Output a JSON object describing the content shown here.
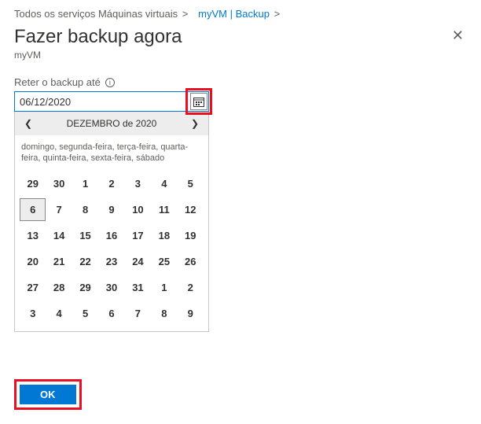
{
  "breadcrumbs": {
    "item1": "Todos os serviços",
    "item2": "Máquinas virtuais",
    "item3": "myVM | Backup",
    "sep": ">"
  },
  "header": {
    "title": "Fazer backup agora",
    "subtitle": "myVM",
    "close_glyph": "✕"
  },
  "field": {
    "label": "Reter o backup até",
    "info_glyph": "i",
    "value": "06/12/2020"
  },
  "calendar": {
    "title": "DEZEMBRO de 2020",
    "prev_glyph": "❮",
    "next_glyph": "❯",
    "daynames": "domingo, segunda-feira, terça-feira, quarta-feira, quinta-feira, sexta-feira, sábado",
    "weeks": [
      [
        {
          "d": "29",
          "other": true
        },
        {
          "d": "30",
          "other": true
        },
        {
          "d": "1"
        },
        {
          "d": "2"
        },
        {
          "d": "3"
        },
        {
          "d": "4"
        },
        {
          "d": "5"
        }
      ],
      [
        {
          "d": "6",
          "selected": true
        },
        {
          "d": "7"
        },
        {
          "d": "8"
        },
        {
          "d": "9"
        },
        {
          "d": "10"
        },
        {
          "d": "11"
        },
        {
          "d": "12"
        }
      ],
      [
        {
          "d": "13"
        },
        {
          "d": "14"
        },
        {
          "d": "15"
        },
        {
          "d": "16"
        },
        {
          "d": "17"
        },
        {
          "d": "18"
        },
        {
          "d": "19"
        }
      ],
      [
        {
          "d": "20"
        },
        {
          "d": "21"
        },
        {
          "d": "22"
        },
        {
          "d": "23"
        },
        {
          "d": "24"
        },
        {
          "d": "25"
        },
        {
          "d": "26"
        }
      ],
      [
        {
          "d": "27"
        },
        {
          "d": "28"
        },
        {
          "d": "29"
        },
        {
          "d": "30"
        },
        {
          "d": "31"
        },
        {
          "d": "1",
          "other": true
        },
        {
          "d": "2",
          "other": true
        }
      ],
      [
        {
          "d": "3",
          "other": true
        },
        {
          "d": "4",
          "other": true
        },
        {
          "d": "5",
          "other": true
        },
        {
          "d": "6",
          "other": true
        },
        {
          "d": "7",
          "other": true
        },
        {
          "d": "8",
          "other": true
        },
        {
          "d": "9",
          "other": true
        }
      ]
    ]
  },
  "footer": {
    "ok_label": "OK"
  },
  "colors": {
    "accent": "#0078d4",
    "highlight_border": "#e81123"
  }
}
